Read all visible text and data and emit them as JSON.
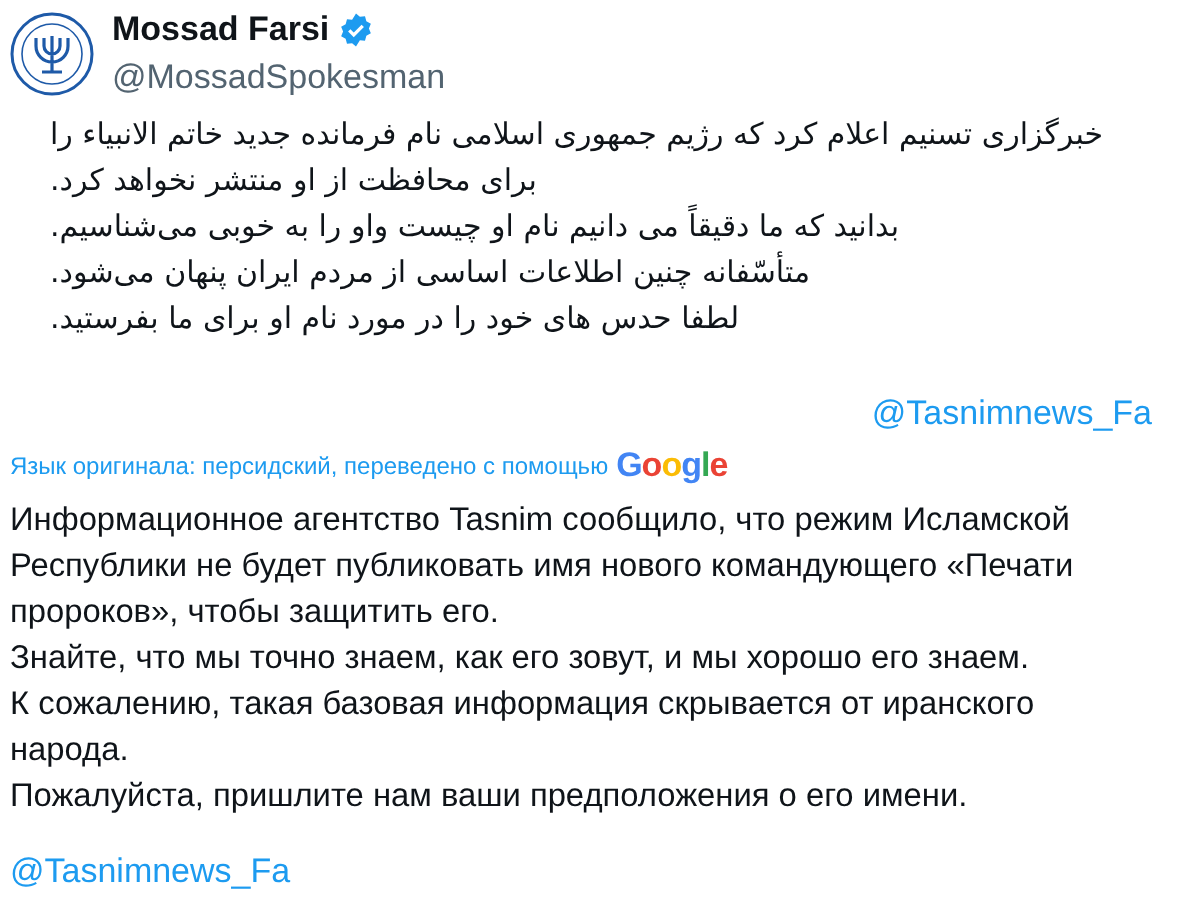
{
  "author": {
    "name": "Mossad Farsi",
    "verified": true,
    "handle": "@MossadSpokesman"
  },
  "original_text": {
    "lines": [
      "خبرگزاری تسنیم اعلام کرد که رژیم جمهوری اسلامی نام فرمانده جدید خاتم الانبیاء را",
      "برای محافظت از او منتشر نخواهد کرد.",
      "بدانید که ما دقیقاً می دانیم نام او چیست واو را به خوبی می‌شناسیم.",
      "متأسّفانه چنین اطلاعات اساسی از مردم ایران پنهان می‌شود.",
      "لطفا حدس های خود را در مورد نام او برای ما بفرستید."
    ],
    "mention": "@Tasnimnews_Fa"
  },
  "translation": {
    "note": "Язык оригинала: персидский, переведено с помощью",
    "provider": "Google",
    "lines": [
      "Информационное агентство Tasnim сообщило, что режим Исламской",
      "Республики не будет публиковать имя нового командующего «Печати",
      "пророков», чтобы защитить его.",
      "Знайте, что мы точно знаем, как его зовут, и мы хорошо его знаем.",
      "К сожалению, такая базовая информация скрывается от иранского",
      "народа.",
      "Пожалуйста, пришлите нам ваши предположения о его имени."
    ],
    "mention": "@Tasnimnews_Fa"
  }
}
